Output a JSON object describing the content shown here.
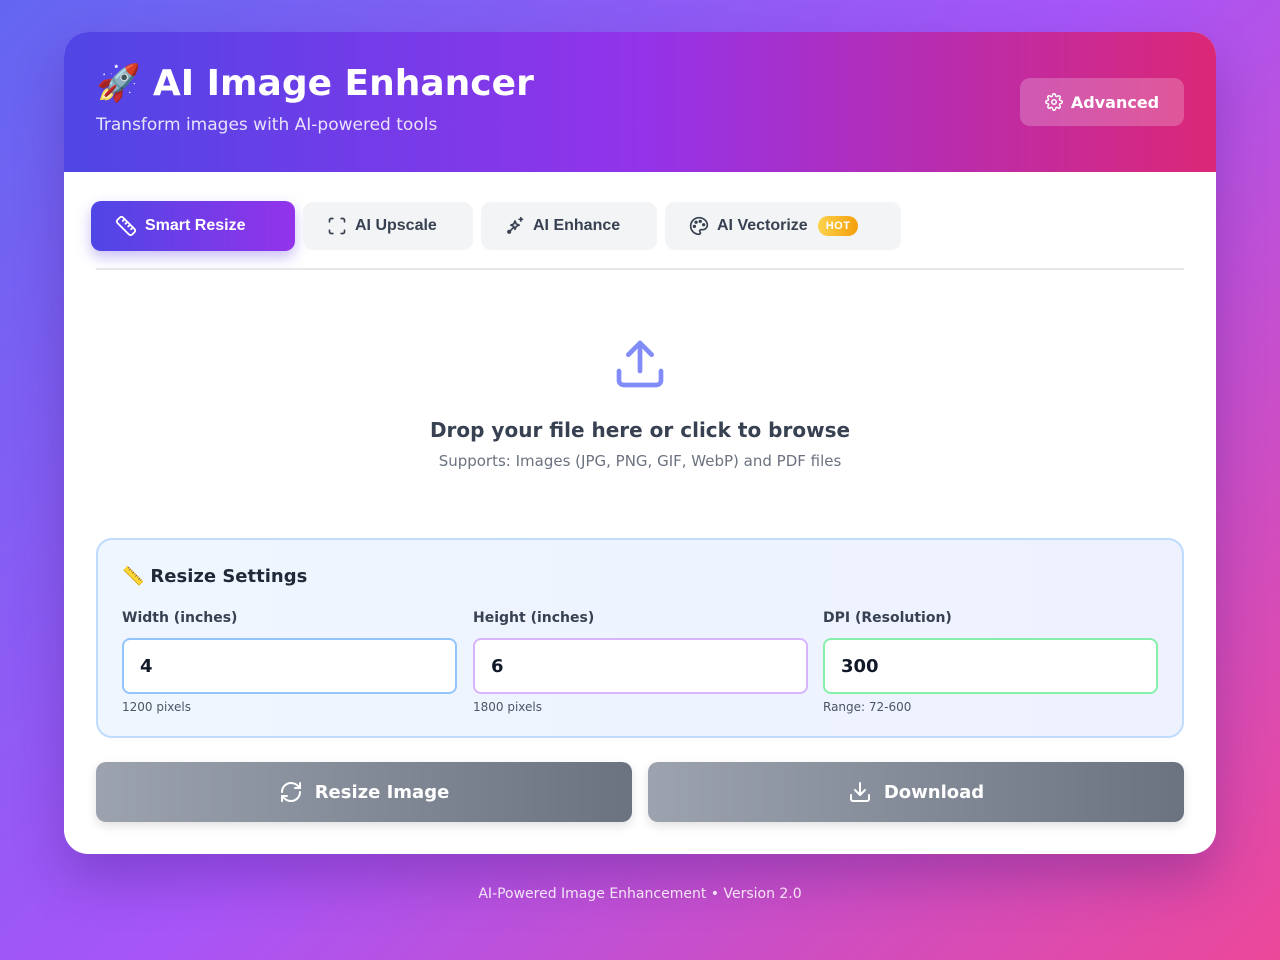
{
  "header": {
    "emoji": "🚀",
    "title": "AI Image Enhancer",
    "subtitle": "Transform images with AI-powered tools",
    "advanced_label": "Advanced"
  },
  "tabs": [
    {
      "label": "Smart Resize",
      "icon": "ruler-icon",
      "active": true
    },
    {
      "label": "AI Upscale",
      "icon": "expand-icon",
      "active": false
    },
    {
      "label": "AI Enhance",
      "icon": "sparkles-icon",
      "active": false
    },
    {
      "label": "AI Vectorize",
      "icon": "palette-icon",
      "active": false,
      "badge": "HOT"
    }
  ],
  "dropzone": {
    "title": "Drop your file here or click to browse",
    "subtitle": "Supports: Images (JPG, PNG, GIF, WebP) and PDF files"
  },
  "settings": {
    "emoji": "📏",
    "title": "Resize Settings",
    "width": {
      "label": "Width (inches)",
      "value": "4",
      "hint": "1200 pixels"
    },
    "height": {
      "label": "Height (inches)",
      "value": "6",
      "hint": "1800 pixels"
    },
    "dpi": {
      "label": "DPI (Resolution)",
      "value": "300",
      "hint": "Range: 72-600"
    }
  },
  "actions": {
    "resize_label": "Resize Image",
    "download_label": "Download"
  },
  "footer": "AI-Powered Image Enhancement • Version 2.0",
  "colors": {
    "accent_start": "#4f46e5",
    "accent_end": "#9333ea",
    "header_end": "#db2777",
    "upload_icon": "#818cf8"
  }
}
